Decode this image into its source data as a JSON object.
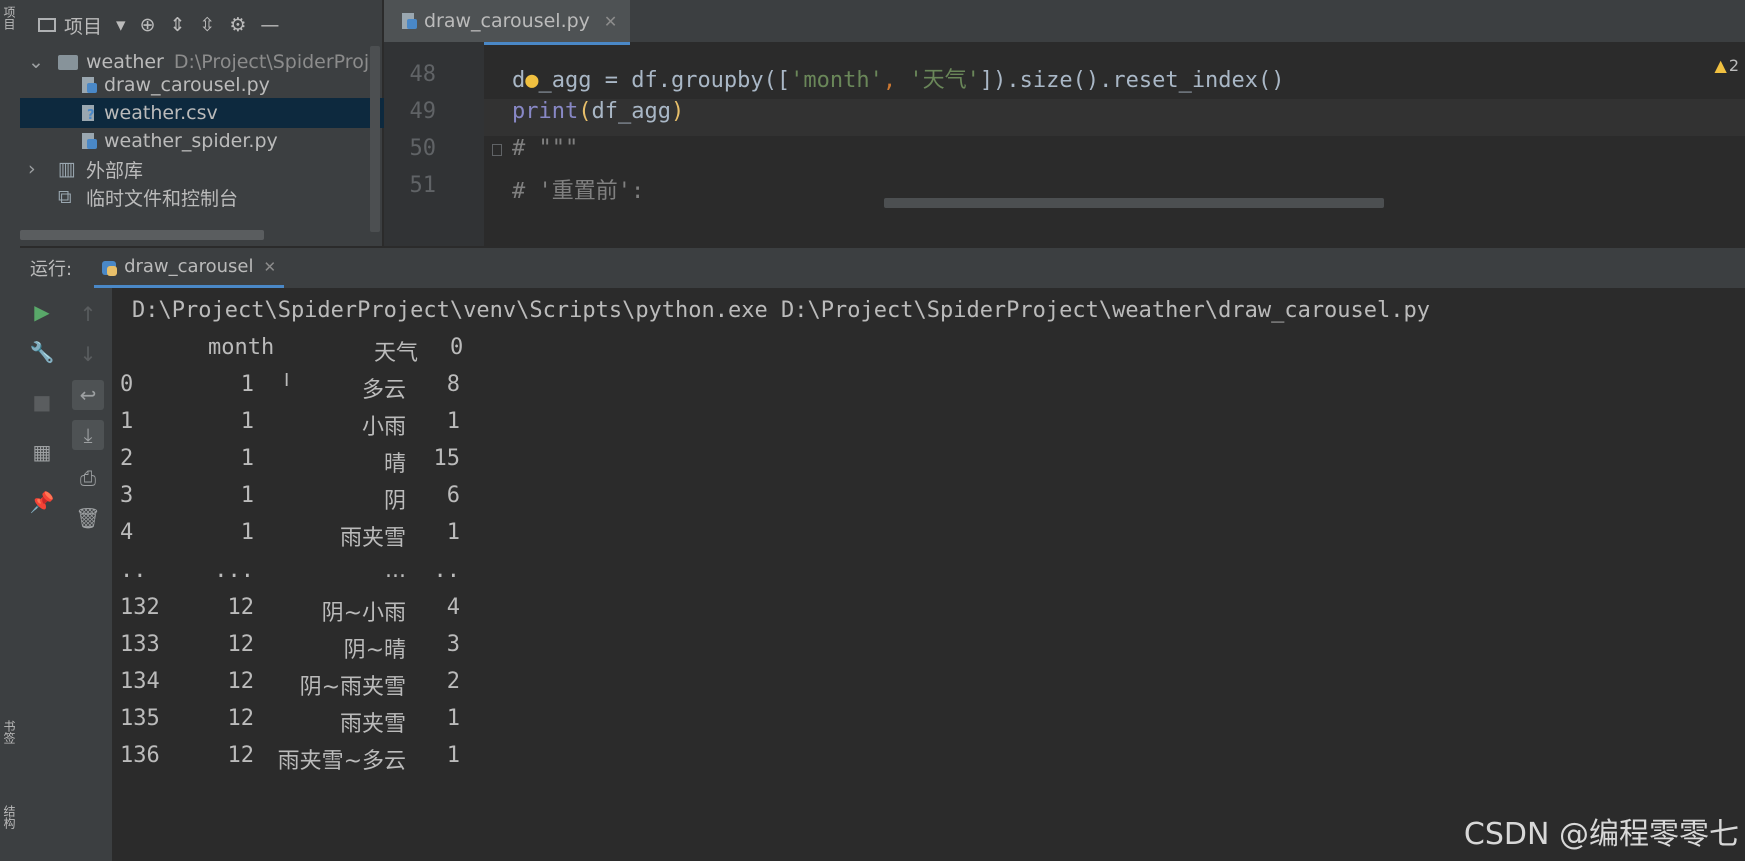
{
  "sidebar": {
    "project_tab": "项目",
    "bookmarks_tab": "书签",
    "structure_tab": "结构"
  },
  "project_panel": {
    "title": "项目",
    "tree": [
      {
        "label": "weather",
        "path": "D:\\Project\\SpiderProj"
      },
      {
        "label": "draw_carousel.py"
      },
      {
        "label": "weather.csv"
      },
      {
        "label": "weather_spider.py"
      },
      {
        "label": "外部库"
      },
      {
        "label": "临时文件和控制台"
      }
    ]
  },
  "editor": {
    "tab_label": "draw_carousel.py",
    "warning_count": "2",
    "lines": [
      {
        "num": "48",
        "code": "df_agg = df.groupby(['month', '天气']).size().reset_index()"
      },
      {
        "num": "49",
        "code": "print(df_agg)"
      },
      {
        "num": "50",
        "code": "# \"\"\""
      },
      {
        "num": "51",
        "code": "# '重置前':"
      }
    ]
  },
  "run": {
    "label": "运行:",
    "tab_label": "draw_carousel",
    "command": "D:\\Project\\SpiderProject\\venv\\Scripts\\python.exe D:\\Project\\SpiderProject\\weather\\draw_carousel.py",
    "header": {
      "month": "month",
      "weather": "天气",
      "count": "0"
    },
    "rows": [
      {
        "idx": "0",
        "month": "1",
        "weather": "多云",
        "count": "8"
      },
      {
        "idx": "1",
        "month": "1",
        "weather": "小雨",
        "count": "1"
      },
      {
        "idx": "2",
        "month": "1",
        "weather": "晴",
        "count": "15"
      },
      {
        "idx": "3",
        "month": "1",
        "weather": "阴",
        "count": "6"
      },
      {
        "idx": "4",
        "month": "1",
        "weather": "雨夹雪",
        "count": "1"
      },
      {
        "idx": "..",
        "month": "...",
        "weather": "...",
        "count": ".."
      },
      {
        "idx": "132",
        "month": "12",
        "weather": "阴~小雨",
        "count": "4"
      },
      {
        "idx": "133",
        "month": "12",
        "weather": "阴~晴",
        "count": "3"
      },
      {
        "idx": "134",
        "month": "12",
        "weather": "阴~雨夹雪",
        "count": "2"
      },
      {
        "idx": "135",
        "month": "12",
        "weather": "雨夹雪",
        "count": "1"
      },
      {
        "idx": "136",
        "month": "12",
        "weather": "雨夹雪~多云",
        "count": "1"
      }
    ]
  },
  "watermark": "CSDN @编程零零七",
  "colors": {
    "keyword": "#cc7832",
    "string": "#6a8759",
    "builtin": "#8888c6",
    "comment": "#808080",
    "accent": "#4a88c7"
  }
}
